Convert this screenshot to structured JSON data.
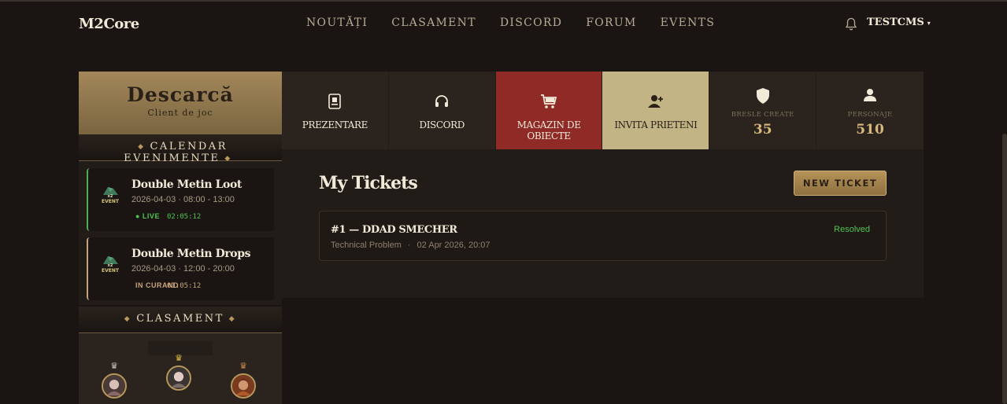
{
  "brand": {
    "logo": "M2Core"
  },
  "nav": {
    "items": [
      "NOUTĂȚI",
      "CLASAMENT",
      "DISCORD",
      "FORUM",
      "EVENTS"
    ]
  },
  "user": {
    "name": "TESTCMS",
    "caret": "▾",
    "bell_icon": "bell-icon"
  },
  "download": {
    "title": "Descarcă",
    "subtitle": "Client de joc"
  },
  "calendar": {
    "heading": "CALENDAR EVENIMENTE",
    "events": [
      {
        "name": "Double Metin Loot",
        "time": "2026-04-03 · 08:00 - 13:00",
        "status": "● LIVE",
        "timer": "02:05:12"
      },
      {
        "name": "Double Metin Drops",
        "time": "2026-04-03 · 12:00 - 20:00",
        "status": "IN CURAND",
        "timer": "01:05:12"
      }
    ]
  },
  "ranking": {
    "heading": "CLASAMENT",
    "crown_icon": "crown-icon"
  },
  "quick": [
    {
      "label": "PREZENTARE",
      "icon": "presentation-icon"
    },
    {
      "label": "DISCORD",
      "icon": "headset-icon"
    },
    {
      "label": "MAGAZIN DE OBIECTE",
      "icon": "cart-icon"
    },
    {
      "label": "INVITA PRIETENI",
      "icon": "add-user-icon"
    }
  ],
  "stats": [
    {
      "label": "BRESLE CREATE",
      "value": "35",
      "icon": "shield-icon"
    },
    {
      "label": "PERSONAJE",
      "value": "510",
      "icon": "user-icon"
    }
  ],
  "tickets": {
    "title": "My Tickets",
    "new_button": "NEW TICKET",
    "items": [
      {
        "title": "#1 — DDAD SMECHER",
        "category": "Technical Problem",
        "sep": "·",
        "date": "02 Apr 2026, 20:07",
        "status": "Resolved"
      }
    ]
  },
  "colors": {
    "accent_gold": "#b59358",
    "red_tile": "#8f2a27",
    "beige_tile": "#c3b486",
    "live_green": "#4fc44f"
  }
}
